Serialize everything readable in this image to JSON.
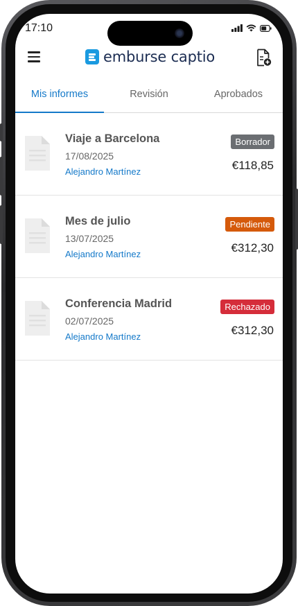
{
  "status": {
    "time": "17:10"
  },
  "header": {
    "brand": "emburse captio",
    "menu_icon": "hamburger-menu-icon",
    "new_report_icon": "add-document-icon"
  },
  "tabs": [
    {
      "label": "Mis informes",
      "active": true
    },
    {
      "label": "Revisión",
      "active": false
    },
    {
      "label": "Aprobados",
      "active": false
    }
  ],
  "reports": [
    {
      "title": "Viaje a Barcelona",
      "date": "17/08/2025",
      "owner": "Alejandro Martínez",
      "status": "Borrador",
      "status_color": "#6b6e72",
      "amount": "€118,85"
    },
    {
      "title": "Mes de julio",
      "date": "13/07/2025",
      "owner": "Alejandro Martínez",
      "status": "Pendiente",
      "status_color": "#d55a0b",
      "amount": "€312,30"
    },
    {
      "title": "Conferencia Madrid",
      "date": "02/07/2025",
      "owner": "Alejandro Martínez",
      "status": "Rechazado",
      "status_color": "#d52d3a",
      "amount": "€312,30"
    }
  ],
  "colors": {
    "accent": "#1479c9",
    "brand_mark": "#1a9ae0",
    "brand_text": "#1c2d52"
  }
}
